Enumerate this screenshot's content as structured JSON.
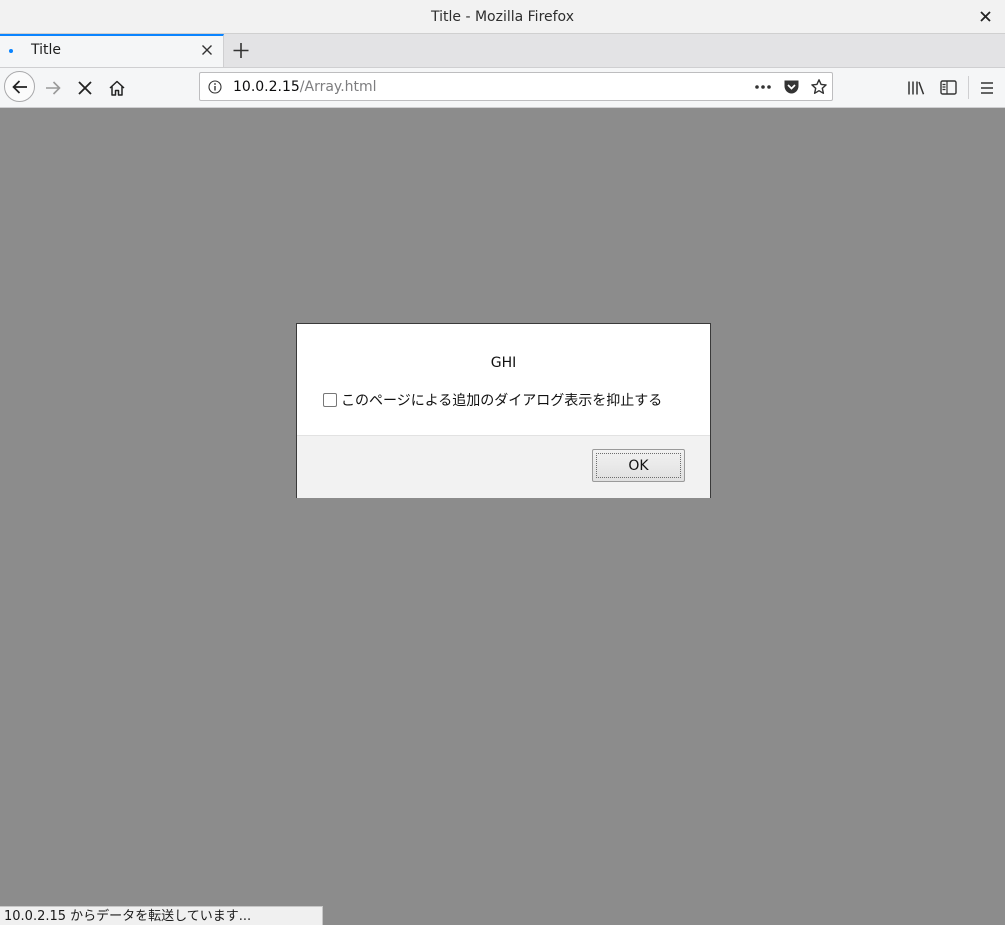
{
  "window": {
    "title": "Title - Mozilla Firefox"
  },
  "tabs": [
    {
      "label": "Title",
      "active": true
    }
  ],
  "navigation": {
    "url_host": "10.0.2.15",
    "url_path": "/Array.html"
  },
  "dialog": {
    "message": "GHI",
    "checkbox_label": "このページによる追加のダイアログ表示を抑止する",
    "checkbox_checked": false,
    "ok_label": "OK"
  },
  "status": {
    "text": "10.0.2.15 からデータを転送しています..."
  },
  "colors": {
    "accent": "#0a84ff",
    "content_overlay": "#8c8c8c",
    "chrome": "#f5f6f7"
  },
  "icons": [
    "close-icon",
    "new-tab-icon",
    "back-arrow-icon",
    "forward-arrow-icon",
    "stop-icon",
    "home-icon",
    "info-icon",
    "more-actions-icon",
    "pocket-icon",
    "bookmark-star-icon",
    "library-icon",
    "sidebar-icon",
    "menu-hamburger-icon"
  ]
}
